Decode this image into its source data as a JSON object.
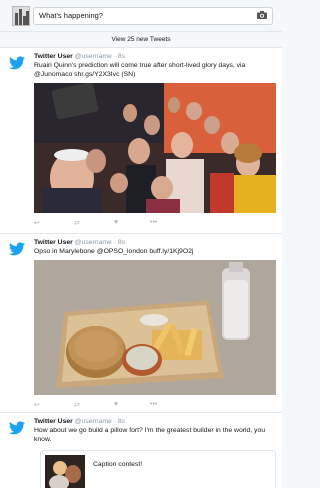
{
  "compose": {
    "placeholder": "What's happening?",
    "camera_icon": "camera-icon",
    "avatar_icon": "city-skyline-icon"
  },
  "new_tweets": {
    "label": "View 25 new Tweets"
  },
  "tweets": [
    {
      "name": "Twitter User",
      "handle": "@username",
      "time": "· 8s",
      "text": "Ruairi Quinn's prediction will come true after short-lived glory days, via @Junomaco shr.gs/Y2X3Ivc (SN)",
      "media": "group-selfie-photo"
    },
    {
      "name": "Twitter User",
      "handle": "@username",
      "time": "· 8s",
      "text": "Opso in Marylebone @OPSO_london buff.ly/1Kj9O2j",
      "media": "food-tray-photo"
    },
    {
      "name": "Twitter User",
      "handle": "@username",
      "time": "· 8s",
      "text": "How about we go build a pillow fort? I'm the greatest builder in the world, you know.",
      "card": {
        "caption": "Caption contest!"
      }
    }
  ],
  "icons": {
    "bird": "twitter-bird-icon",
    "reply": "reply-icon",
    "retweet": "retweet-icon",
    "like": "heart-icon",
    "more": "more-icon"
  },
  "colors": {
    "brand": "#1da1f2",
    "background": "#f5f8fa",
    "muted": "#8899a6",
    "action": "#aab8c2",
    "border": "#e1e8ed"
  }
}
